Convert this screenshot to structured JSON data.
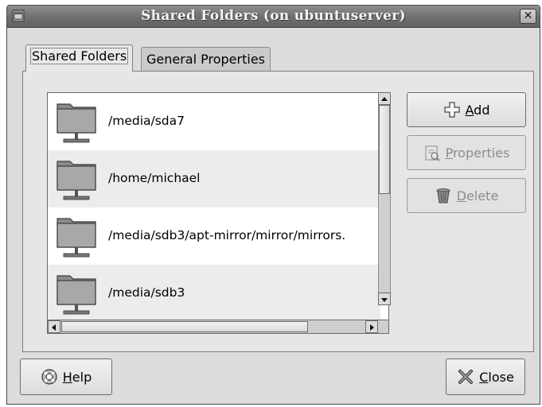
{
  "window": {
    "title": "Shared Folders (on ubuntuserver)"
  },
  "tabs": [
    {
      "label": "Shared Folders",
      "active": true
    },
    {
      "label": "General Properties",
      "active": false
    }
  ],
  "folders": [
    {
      "path": "/media/sda7"
    },
    {
      "path": "/home/michael"
    },
    {
      "path": "/media/sdb3/apt-mirror/mirror/mirrors."
    },
    {
      "path": "/media/sdb3"
    }
  ],
  "actions": {
    "add": {
      "accel": "A",
      "rest": "dd",
      "enabled": true
    },
    "properties": {
      "accel": "P",
      "rest": "roperties",
      "enabled": false
    },
    "delete": {
      "accel": "D",
      "rest": "elete",
      "enabled": false
    }
  },
  "footer": {
    "help": {
      "accel": "H",
      "rest": "elp"
    },
    "close": {
      "accel": "C",
      "rest": "lose"
    }
  },
  "icons": {
    "window_menu": "window-menu-icon",
    "close_window": "close-window-icon",
    "folder": "network-folder-icon",
    "add": "plus-icon",
    "properties": "properties-icon",
    "delete": "trash-icon",
    "help": "lifebuoy-icon",
    "close": "x-icon"
  }
}
